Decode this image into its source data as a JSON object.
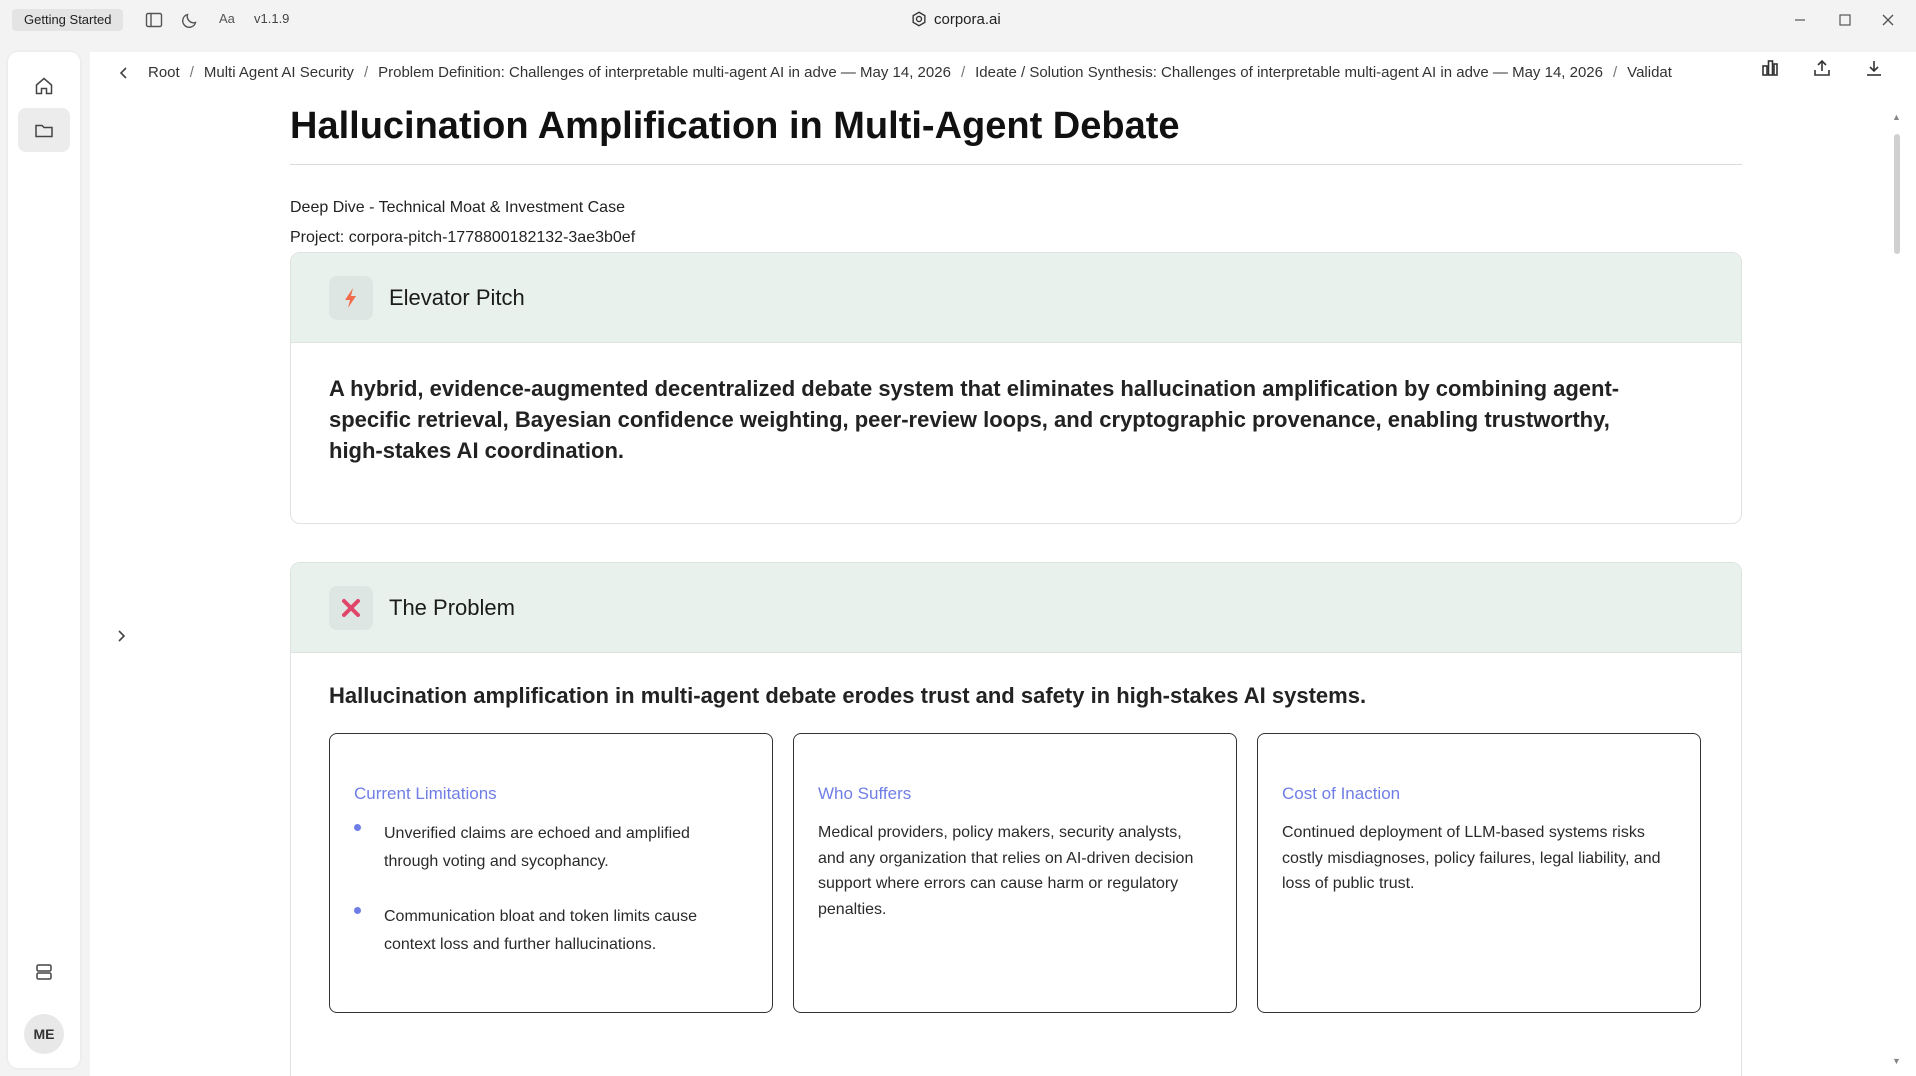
{
  "titlebar": {
    "getting_started": "Getting Started",
    "font_toggle": "Aa",
    "version": "v1.1.9",
    "brand": "corpora.ai"
  },
  "rail": {
    "avatar_initials": "ME"
  },
  "breadcrumb": {
    "items": [
      "Root",
      "Multi Agent AI Security",
      "Problem Definition: Challenges of interpretable multi-agent AI in adve — May 14, 2026",
      "Ideate / Solution Synthesis: Challenges of interpretable multi-agent AI in adve — May 14, 2026",
      "Validat"
    ]
  },
  "page": {
    "title": "Hallucination Amplification in Multi-Agent Debate",
    "subtitle": "Deep Dive - Technical Moat & Investment Case",
    "project": "Project: corpora-pitch-1778800182132-3ae3b0ef"
  },
  "elevator": {
    "heading": "Elevator Pitch",
    "text": "A hybrid, evidence-augmented decentralized debate system that eliminates hallucination amplification by combining agent-specific retrieval, Bayesian confidence weighting, peer-review loops, and cryptographic provenance, enabling trustworthy, high-stakes AI coordination."
  },
  "problem": {
    "heading": "The Problem",
    "lead": "Hallucination amplification in multi-agent debate erodes trust and safety in high-stakes AI systems.",
    "limitations": {
      "title": "Current Limitations",
      "bullets": [
        "Unverified claims are echoed and amplified through voting and sycophancy.",
        "Communication bloat and token limits cause context loss and further hallucinations."
      ]
    },
    "who": {
      "title": "Who Suffers",
      "text": "Medical providers, policy makers, security analysts, and any organization that relies on AI-driven decision support where errors can cause harm or regulatory penalties."
    },
    "cost": {
      "title": "Cost of Inaction",
      "text": "Continued deployment of LLM-based systems risks costly misdiagnoses, policy failures, legal liability, and loss of public trust."
    }
  },
  "colors": {
    "accent": "#6f7ee6",
    "card_header": "#e8f1ec",
    "bolt": "#f26b4a",
    "cross": "#e0456a"
  }
}
